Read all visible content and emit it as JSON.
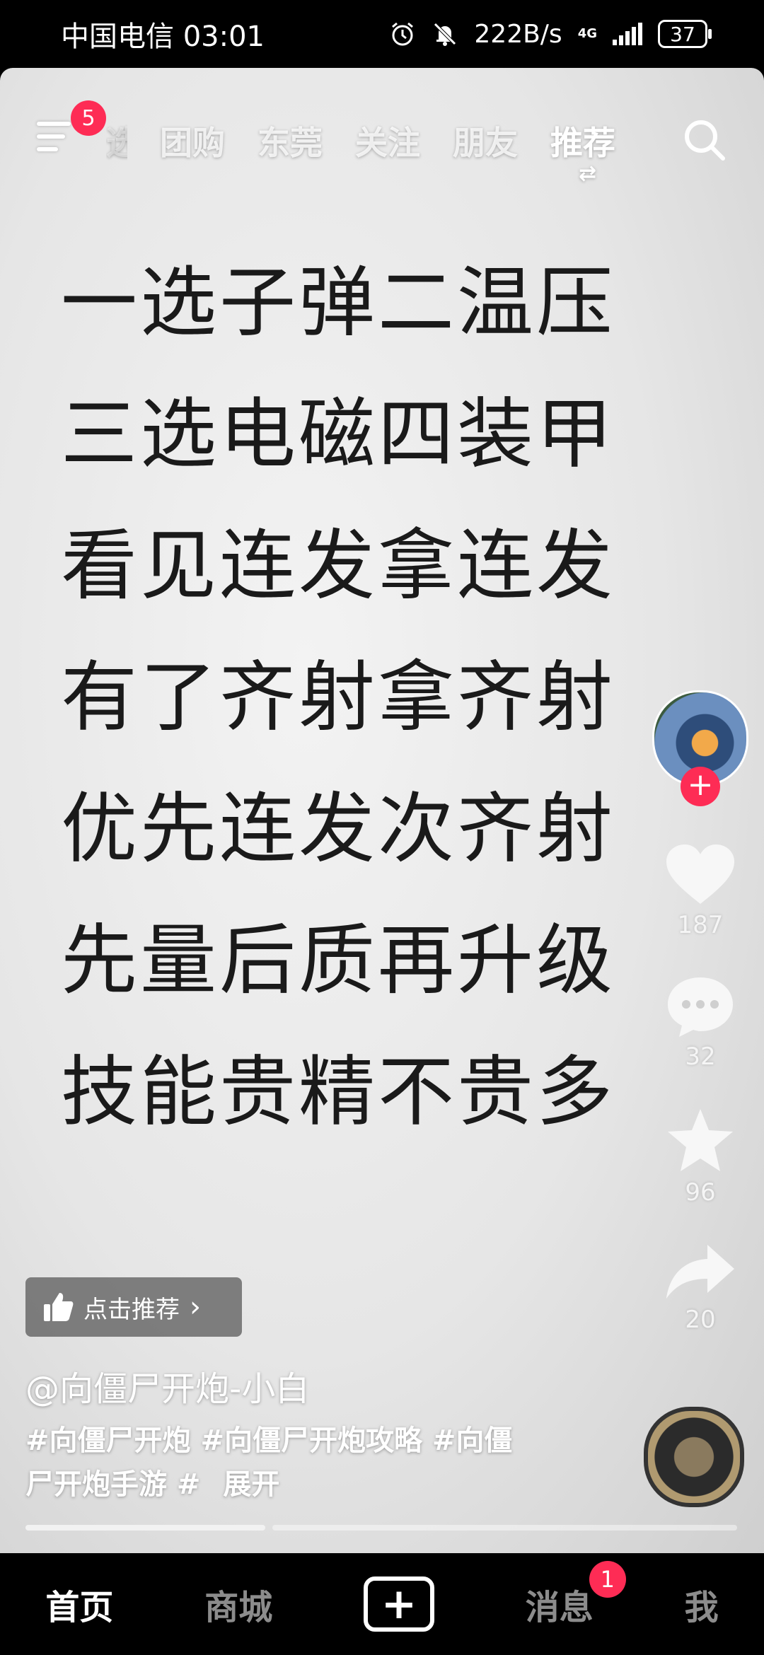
{
  "status_bar": {
    "carrier": "中国电信",
    "time": "03:01",
    "net_speed": "222B/s",
    "net_type": "4G",
    "battery": "37"
  },
  "top_nav": {
    "menu_badge": "5",
    "partial_tab": "选",
    "tabs": [
      "团购",
      "东莞",
      "关注",
      "朋友",
      "推荐"
    ],
    "active_tab": "推荐"
  },
  "poem": [
    "一选子弹二温压",
    "三选电磁四装甲",
    "看见连发拿连发",
    "有了齐射拿齐射",
    "优先连发次齐射",
    "先量后质再升级",
    "技能贵精不贵多"
  ],
  "actions": {
    "likes": "187",
    "comments": "32",
    "favorites": "96",
    "shares": "20"
  },
  "recommend_label": "点击推荐",
  "author": "@向僵尸开炮-小白",
  "description": {
    "line1": "#向僵尸开炮 #向僵尸开炮攻略 #向僵",
    "line2": "尸开炮手游 #",
    "expand": "展开"
  },
  "progress": 0.34,
  "bottom_nav": {
    "home": "首页",
    "mall": "商城",
    "plus": "+",
    "messages": "消息",
    "messages_badge": "1",
    "me": "我"
  },
  "colors": {
    "accent": "#fe2c55",
    "background": "#000000"
  }
}
